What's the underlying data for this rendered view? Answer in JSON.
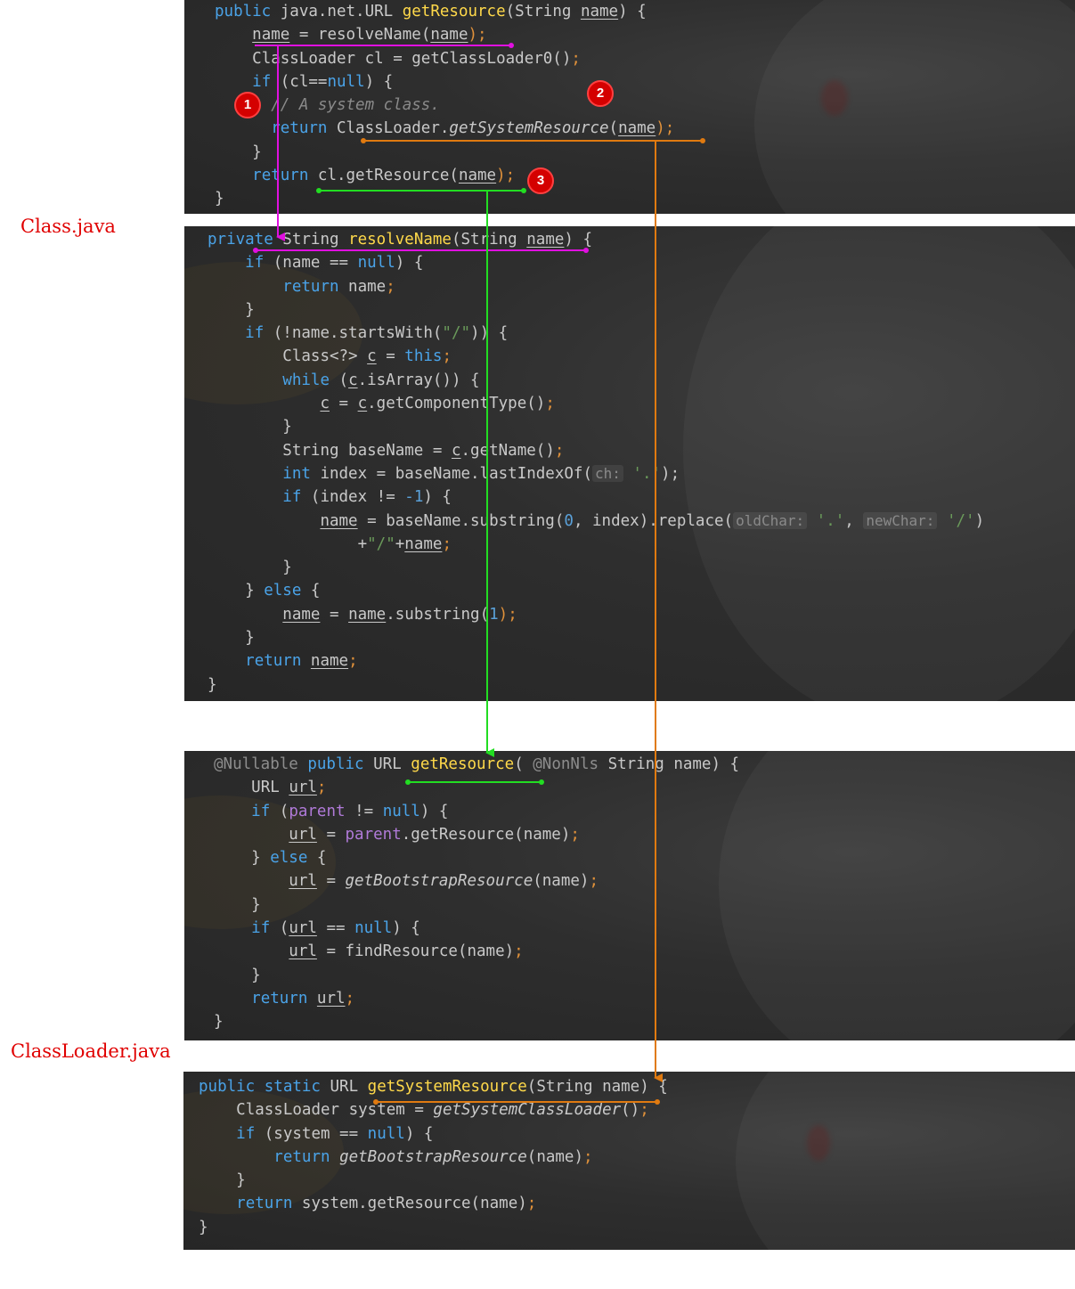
{
  "labels": {
    "class_file": "Class.java",
    "classloader_file": "ClassLoader.java"
  },
  "badges": [
    "1",
    "2",
    "3"
  ],
  "colors": {
    "arrow_magenta": "#e010e0",
    "arrow_green": "#22dd22",
    "arrow_orange": "#e07a10",
    "badge_red": "#d40000",
    "label_red": "#e00000"
  },
  "code": {
    "class_get_resource": {
      "l1_k": "public",
      "l1_t": " java.net.URL ",
      "l1_f": "getResource",
      "l1_a": "(String ",
      "l1_u": "name",
      "l1_e": ") {",
      "l2_u1": "name",
      "l2_m": " = resolveName(",
      "l2_u2": "name",
      "l2_e": ");",
      "l3": "ClassLoader cl = getClassLoader0()",
      "l3_e": ";",
      "l4_k": "if",
      "l4_a": " (cl==",
      "l4_n": "null",
      "l4_e": ") {",
      "l5": "// A system class.",
      "l6_k": "return",
      "l6_a": " ClassLoader.",
      "l6_i": "getSystemResource",
      "l6_b": "(",
      "l6_u": "name",
      "l6_e": ");",
      "l7": "}",
      "l8_k": "return",
      "l8_a": " cl.getResource(",
      "l8_u": "name",
      "l8_e": ");",
      "l9": "}"
    },
    "class_resolve_name": {
      "l1_k": "private",
      "l1_a": " String ",
      "l1_f": "resolveName",
      "l1_b": "(String ",
      "l1_u": "name",
      "l1_e": ") {",
      "l2_k": "if",
      "l2_a": " (name == ",
      "l2_n": "null",
      "l2_e": ") {",
      "l3_k": "return",
      "l3_a": " name",
      "l3_e": ";",
      "l4": "}",
      "l5_k": "if",
      "l5_a": " (!name.startsWith(",
      "l5_s": "\"/\"",
      "l5_e": ")) {",
      "l6_a": "Class<?> ",
      "l6_u": "c",
      "l6_m": " = ",
      "l6_k": "this",
      "l6_e": ";",
      "l7_k": "while",
      "l7_a": " (",
      "l7_u": "c",
      "l7_e": ".isArray()) {",
      "l8_u1": "c",
      "l8_m": " = ",
      "l8_u2": "c",
      "l8_e": ".getComponentType()",
      "l8_p": ";",
      "l9": "}",
      "l10_a": "String baseName = ",
      "l10_u": "c",
      "l10_e": ".getName()",
      "l10_p": ";",
      "l11_k": "int",
      "l11_a": " index = baseName.lastIndexOf(",
      "l11_h": "ch:",
      "l11_s": " '.'",
      "l11_e": ");",
      "l12_k": "if",
      "l12_a": " (index != ",
      "l12_n": "-1",
      "l12_e": ") {",
      "l13_u": "name",
      "l13_a": " = baseName.substring(",
      "l13_n": "0",
      "l13_b": ", index).replace(",
      "l13_h1": "oldChar:",
      "l13_s1": " '.'",
      "l13_c": ", ",
      "l13_h2": "newChar:",
      "l13_s2": " '/'",
      "l13_e": ")",
      "l14_a": "+",
      "l14_s": "\"/\"",
      "l14_b": "+",
      "l14_u": "name",
      "l14_e": ";",
      "l15": "}",
      "l16_a": "} ",
      "l16_k": "else",
      "l16_e": " {",
      "l17_u1": "name",
      "l17_m": " = ",
      "l17_u2": "name",
      "l17_a": ".substring(",
      "l17_n": "1",
      "l17_e": ");",
      "l18": "}",
      "l19_k": "return",
      "l19_a": " ",
      "l19_u": "name",
      "l19_e": ";",
      "l20": "}"
    },
    "loader_get_resource": {
      "l1_ann1": "@Nullable",
      "l1_k": " public",
      "l1_a": " URL ",
      "l1_f": "getResource",
      "l1_b": "( ",
      "l1_ann2": "@NonNls",
      "l1_c": " String name) {",
      "l2_a": "URL ",
      "l2_u": "url",
      "l2_e": ";",
      "l3_k": "if",
      "l3_a": " (",
      "l3_pv": "parent",
      "l3_b": " != ",
      "l3_n": "null",
      "l3_e": ") {",
      "l4_u": "url",
      "l4_a": " = ",
      "l4_pv": "parent",
      "l4_e": ".getResource(name)",
      "l4_p": ";",
      "l5_a": "} ",
      "l5_k": "else",
      "l5_e": " {",
      "l6_u": "url",
      "l6_a": " = ",
      "l6_i": "getBootstrapResource",
      "l6_e": "(name)",
      "l6_p": ";",
      "l7": "}",
      "l8_k": "if",
      "l8_a": " (",
      "l8_u": "url",
      "l8_b": " == ",
      "l8_n": "null",
      "l8_e": ") {",
      "l9_u": "url",
      "l9_a": " = findResource(name)",
      "l9_p": ";",
      "l10": "}",
      "l11_k": "return",
      "l11_a": " ",
      "l11_u": "url",
      "l11_e": ";",
      "l12": "}"
    },
    "loader_get_system_resource": {
      "l1_k": "public static",
      "l1_a": " URL ",
      "l1_f": "getSystemResource",
      "l1_e": "(String name) {",
      "l2_a": "ClassLoader system = ",
      "l2_i": "getSystemClassLoader",
      "l2_e": "()",
      "l2_p": ";",
      "l3_k": "if",
      "l3_a": " (system == ",
      "l3_n": "null",
      "l3_e": ") {",
      "l4_k": "return",
      "l4_a": " ",
      "l4_i": "getBootstrapResource",
      "l4_e": "(name)",
      "l4_p": ";",
      "l5": "}",
      "l6_k": "return",
      "l6_a": " system.getResource(name)",
      "l6_p": ";",
      "l7": "}"
    }
  }
}
